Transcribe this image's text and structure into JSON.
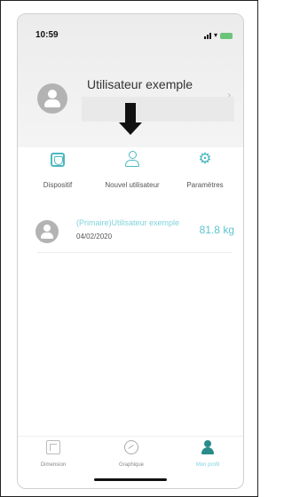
{
  "status_bar": {
    "time": "10:59"
  },
  "header": {
    "user_name": "Utilisateur exemple"
  },
  "actions": [
    {
      "label": "Dispositif",
      "icon": "device-icon"
    },
    {
      "label": "Nouvel utilisateur",
      "icon": "add-user-icon"
    },
    {
      "label": "Paramètres",
      "icon": "gear-icon"
    }
  ],
  "user_row": {
    "name": "(Primaire)Utilisateur exemple",
    "date": "04/02/2020",
    "weight": "81.8 kg"
  },
  "tabbar": [
    {
      "label": "Dimension",
      "icon": "dimension-icon"
    },
    {
      "label": "Graphique",
      "icon": "chart-icon"
    },
    {
      "label": "Mon profil",
      "icon": "profile-icon",
      "active": true
    }
  ],
  "colors": {
    "accent": "#4cb8c0",
    "accent_text": "#7fd3dc",
    "active_tab_icon": "#2a8c8a"
  }
}
